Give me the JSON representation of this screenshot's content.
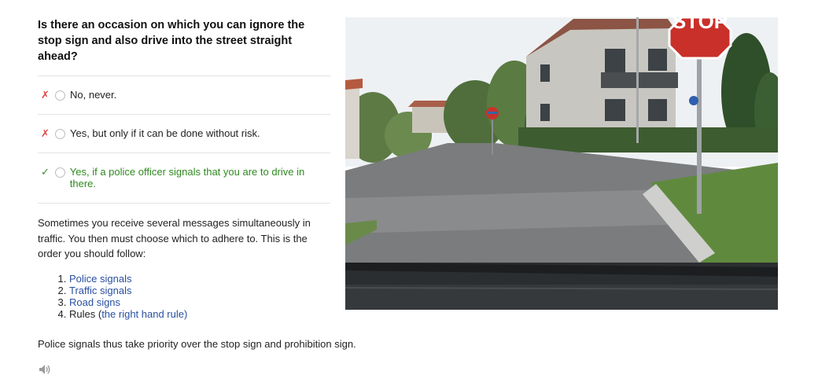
{
  "question": "Is there an occasion on which you can ignore the stop sign and also drive into the street straight ahead?",
  "answers": [
    {
      "text": "No, never.",
      "mark": "✗",
      "correct": false
    },
    {
      "text": "Yes, but only if it can be done without risk.",
      "mark": "✗",
      "correct": false
    },
    {
      "text": "Yes, if a police officer signals that you are to drive in there.",
      "mark": "✓",
      "correct": true
    }
  ],
  "explanation": {
    "intro": "Sometimes you receive several messages simultaneously in traffic. You then must choose which to adhere to. This is the order you should follow:",
    "items": [
      {
        "link": "Police signals"
      },
      {
        "link": "Traffic signals"
      },
      {
        "link": "Road signs"
      },
      {
        "prefix": "Rules (",
        "link": "the right hand rule",
        "suffix": ")"
      }
    ],
    "conclusion": "Police signals thus take priority over the stop sign and prohibition sign."
  },
  "image": {
    "stop_sign_text": "STOP"
  },
  "icons": {
    "audio": "speaker-icon"
  },
  "colors": {
    "correct": "#2f8a1f",
    "wrong": "#e04848",
    "link": "#2a4fa0"
  }
}
